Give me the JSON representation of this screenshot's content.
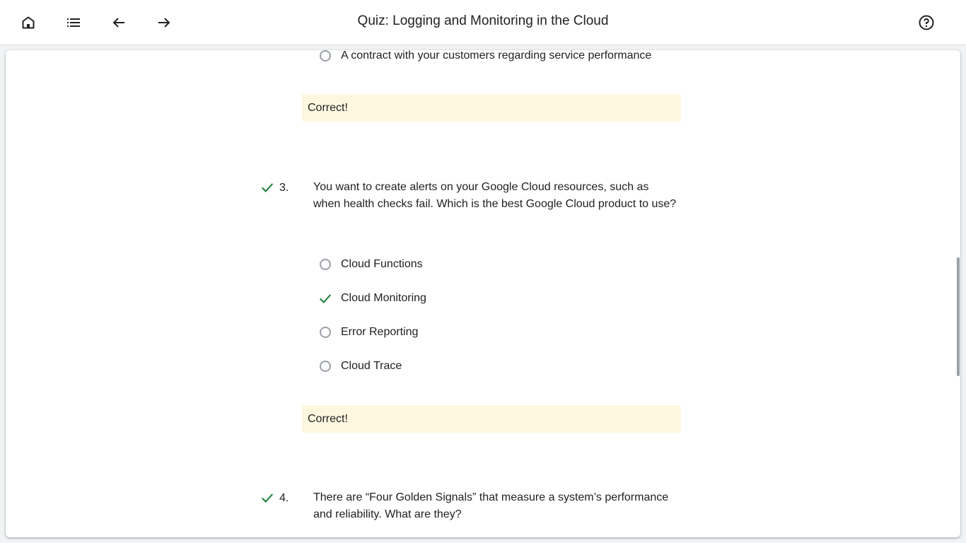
{
  "header": {
    "title": "Quiz: Logging and Monitoring in the Cloud",
    "buttons": {
      "home": "home-icon",
      "outline": "list-icon",
      "previous": "arrow-back-icon",
      "next": "arrow-forward-icon",
      "help": "help-icon"
    }
  },
  "quiz": {
    "q2_last_option": "A contract with your customers regarding service performance",
    "q2_feedback": "Correct!",
    "q3": {
      "number": "3.",
      "text": "You want to create alerts on your Google Cloud resources, such as when health checks fail. Which is the best Google Cloud product to use?",
      "options": [
        {
          "label": "Cloud Functions",
          "state": "unselected"
        },
        {
          "label": "Cloud Monitoring",
          "state": "correct"
        },
        {
          "label": "Error Reporting",
          "state": "unselected"
        },
        {
          "label": "Cloud Trace",
          "state": "unselected"
        }
      ],
      "feedback": "Correct!"
    },
    "q4": {
      "number": "4.",
      "text": "There are “Four Golden Signals” that measure a system’s performance and reliability. What are they?"
    }
  },
  "colors": {
    "correct_check": "#188038",
    "feedback_bg": "#fef7e0",
    "radio_border": "#9aa0a6"
  }
}
